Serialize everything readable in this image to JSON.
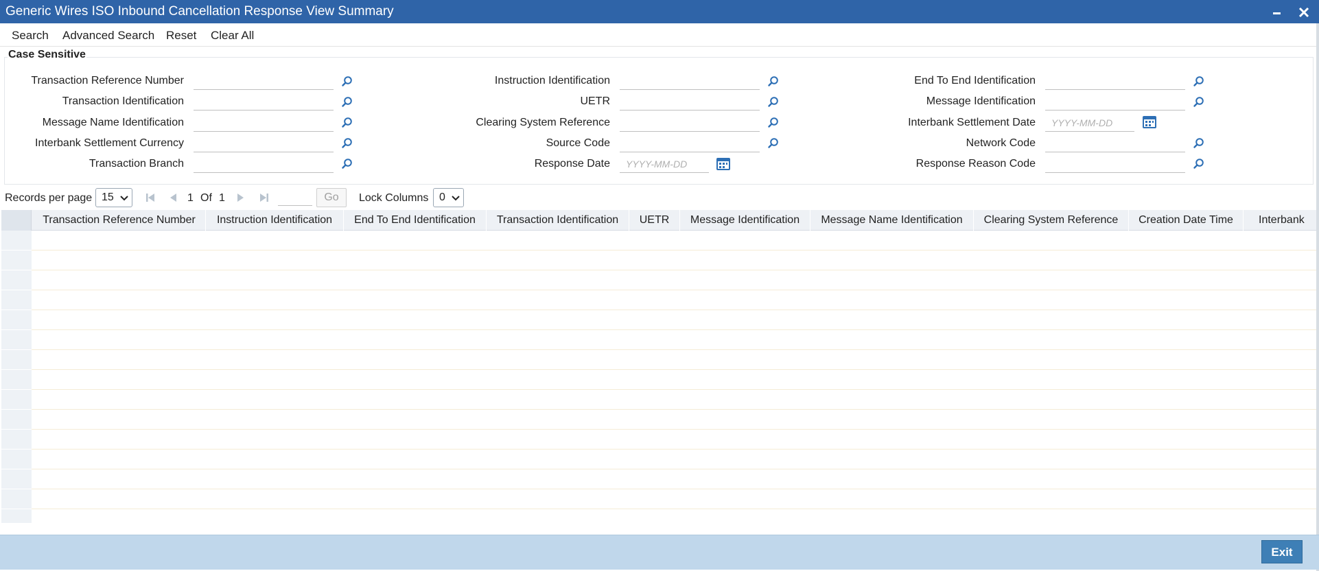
{
  "window": {
    "title": "Generic Wires ISO Inbound Cancellation Response View Summary"
  },
  "menu": {
    "search": "Search",
    "advanced_search": "Advanced Search",
    "reset": "Reset",
    "clear_all": "Clear All"
  },
  "criteria": {
    "legend": "Case Sensitive",
    "col1": [
      {
        "label": "Transaction Reference Number",
        "value": ""
      },
      {
        "label": "Transaction Identification",
        "value": ""
      },
      {
        "label": "Message Name Identification",
        "value": ""
      },
      {
        "label": "Interbank Settlement Currency",
        "value": ""
      },
      {
        "label": "Transaction Branch",
        "value": ""
      }
    ],
    "col2": [
      {
        "label": "Instruction Identification",
        "value": ""
      },
      {
        "label": "UETR",
        "value": ""
      },
      {
        "label": "Clearing System Reference",
        "value": ""
      },
      {
        "label": "Source Code",
        "value": ""
      },
      {
        "label": "Response Date",
        "placeholder": "YYYY-MM-DD"
      }
    ],
    "col3": [
      {
        "label": "End To End Identification",
        "value": ""
      },
      {
        "label": "Message Identification",
        "value": ""
      },
      {
        "label": "Interbank Settlement Date",
        "placeholder": "YYYY-MM-DD"
      },
      {
        "label": "Network Code",
        "value": ""
      },
      {
        "label": "Response Reason Code",
        "value": ""
      }
    ]
  },
  "pager": {
    "records_per_page_label": "Records per page",
    "records_per_page": "15",
    "current_page": "1",
    "of_label": "Of",
    "total_pages": "1",
    "go_label": "Go",
    "lock_columns_label": "Lock Columns",
    "lock_columns": "0"
  },
  "grid": {
    "columns": [
      "Transaction Reference Number",
      "Instruction Identification",
      "End To End Identification",
      "Transaction Identification",
      "UETR",
      "Message Identification",
      "Message Name Identification",
      "Clearing System Reference",
      "Creation Date Time",
      "Interbank"
    ],
    "rows": []
  },
  "footer": {
    "exit_label": "Exit"
  },
  "colors": {
    "titlebar": "#2f64a8",
    "icon_blue": "#2d6fb5",
    "footer": "#c0d7eb",
    "exit_button": "#3e7fb6"
  },
  "icons": {
    "lookup": "magnifier-icon",
    "calendar": "calendar-icon",
    "minimize": "minimize-icon",
    "close": "close-icon"
  }
}
